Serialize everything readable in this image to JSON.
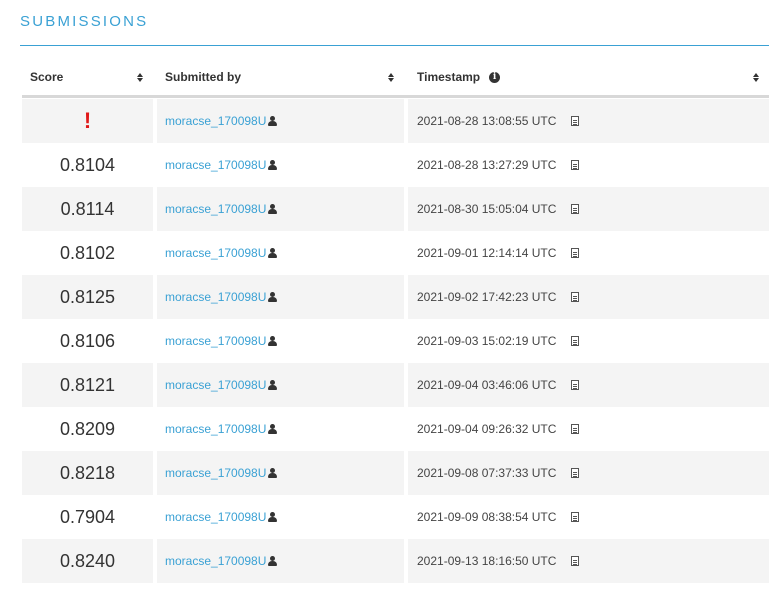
{
  "section": {
    "title": "SUBMISSIONS"
  },
  "table": {
    "headers": {
      "score": "Score",
      "submitted_by": "Submitted by",
      "timestamp": "Timestamp"
    },
    "rows": [
      {
        "score": "!",
        "user": "moracse_170098U",
        "timestamp": "2021-08-28 13:08:55 UTC"
      },
      {
        "score": "0.8104",
        "user": "moracse_170098U",
        "timestamp": "2021-08-28 13:27:29 UTC"
      },
      {
        "score": "0.8114",
        "user": "moracse_170098U",
        "timestamp": "2021-08-30 15:05:04 UTC"
      },
      {
        "score": "0.8102",
        "user": "moracse_170098U",
        "timestamp": "2021-09-01 12:14:14 UTC"
      },
      {
        "score": "0.8125",
        "user": "moracse_170098U",
        "timestamp": "2021-09-02 17:42:23 UTC"
      },
      {
        "score": "0.8106",
        "user": "moracse_170098U",
        "timestamp": "2021-09-03 15:02:19 UTC"
      },
      {
        "score": "0.8121",
        "user": "moracse_170098U",
        "timestamp": "2021-09-04 03:46:06 UTC"
      },
      {
        "score": "0.8209",
        "user": "moracse_170098U",
        "timestamp": "2021-09-04 09:26:32 UTC"
      },
      {
        "score": "0.8218",
        "user": "moracse_170098U",
        "timestamp": "2021-09-08 07:37:33 UTC"
      },
      {
        "score": "0.7904",
        "user": "moracse_170098U",
        "timestamp": "2021-09-09 08:38:54 UTC"
      },
      {
        "score": "0.8240",
        "user": "moracse_170098U",
        "timestamp": "2021-09-13 18:16:50 UTC"
      }
    ]
  },
  "colors": {
    "accent": "#3aa1d4",
    "error": "#e01818",
    "row_shade": "#f4f4f4"
  },
  "icons": {
    "sort": "sort-icon",
    "info": "info-icon",
    "user": "user-icon",
    "details": "document-icon"
  }
}
